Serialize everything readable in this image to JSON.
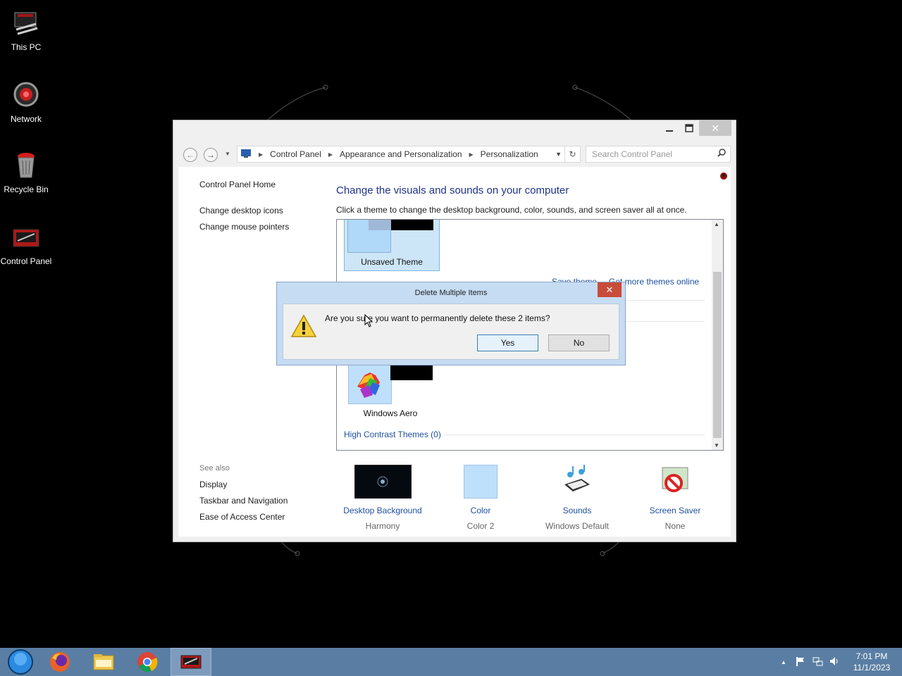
{
  "desktop": {
    "icons": [
      {
        "label": "This PC"
      },
      {
        "label": "Network"
      },
      {
        "label": "Recycle Bin"
      },
      {
        "label": "Control Panel"
      }
    ]
  },
  "window": {
    "address": {
      "crumbs": [
        "Control Panel",
        "Appearance and Personalization",
        "Personalization"
      ]
    },
    "search_placeholder": "Search Control Panel",
    "sidebar": {
      "home": "Control Panel Home",
      "links": [
        "Change desktop icons",
        "Change mouse pointers"
      ],
      "see_also_heading": "See also",
      "see_also": [
        "Display",
        "Taskbar and Navigation",
        "Ease of Access Center"
      ]
    },
    "title": "Change the visuals and sounds on your computer",
    "subtitle": "Click a theme to change the desktop background, color, sounds, and screen saver all at once.",
    "themes": {
      "unsaved_label": "Unsaved Theme",
      "save_theme": "Save theme",
      "get_more": "Get more themes online",
      "aero_label": "Windows Aero",
      "high_contrast": "High Contrast Themes (0)"
    },
    "bottom": [
      {
        "name": "Desktop Background",
        "value": "Harmony"
      },
      {
        "name": "Color",
        "value": "Color 2"
      },
      {
        "name": "Sounds",
        "value": "Windows Default"
      },
      {
        "name": "Screen Saver",
        "value": "None"
      }
    ]
  },
  "dialog": {
    "title": "Delete Multiple Items",
    "message": "Are you sure you want to permanently delete these 2 items?",
    "yes": "Yes",
    "no": "No"
  },
  "taskbar": {
    "time": "7:01 PM",
    "date": "11/1/2023"
  }
}
